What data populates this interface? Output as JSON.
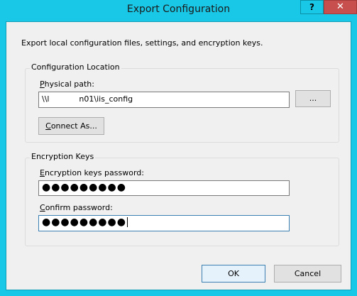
{
  "window": {
    "title": "Export Configuration",
    "help_label": "?",
    "close_label": "✕"
  },
  "description": "Export local configuration files, settings, and encryption keys.",
  "location_group": {
    "title": "Configuration Location",
    "path_label_accel": "P",
    "path_label_rest": "hysical path:",
    "path_value": "\\\\l            n01\\iis_config",
    "browse_label": "...",
    "connect_accel": "C",
    "connect_rest": "onnect As..."
  },
  "keys_group": {
    "title": "Encryption Keys",
    "password_label_accel": "E",
    "password_label_rest": "ncryption keys password:",
    "password_value": "●●●●●●●●●",
    "confirm_label_accel": "C",
    "confirm_label_rest": "onfirm password:",
    "confirm_value": "●●●●●●●●●"
  },
  "footer": {
    "ok_label": "OK",
    "cancel_label": "Cancel"
  }
}
